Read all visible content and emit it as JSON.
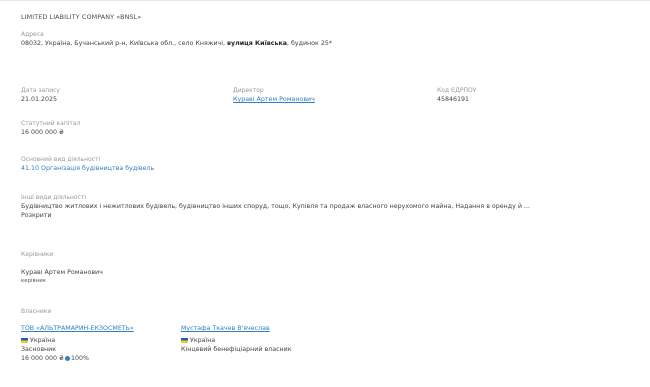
{
  "company": {
    "name": "LIMITED LIABILITY COMPANY «BNSL»"
  },
  "address": {
    "label": "Адреса",
    "prefix": "08032, Україна, Бучанський р-н, Київська обл., село Княжичі, ",
    "street": "вулиця Київська",
    "suffix": ", будинок 25*"
  },
  "registration": {
    "date_label": "Дата запису",
    "date": "21.01.2025",
    "director_label": "Директор",
    "director": "Кураві Артем Романович",
    "code_label": "Код ЄДРПОУ",
    "code": "45846191"
  },
  "capital": {
    "label": "Статутний капітал",
    "value": "16 000 000 ₴"
  },
  "main_activity": {
    "label": "Основний вид діяльності",
    "value": "41.10 Організація будівництва будівель"
  },
  "other_activity": {
    "label": "Інші види діяльності",
    "value": "Будівництво житлових і нежитлових будівель, будівництво інших споруд, тощо, Купівля та продаж власного нерухомого майна, Надання в оренду й ...",
    "expand": "Розкрити"
  },
  "managers": {
    "label": "Керівники",
    "name": "Кураві Артем Романович",
    "role": "керівник"
  },
  "owners": {
    "label": "Власники",
    "owner1": {
      "name": "ТОВ «АЛЬТРАМАРИН-ЕКЗОСМЕТЬ»",
      "country": "Україна",
      "role": "Засновник",
      "share": "16 000 000 ₴",
      "percent": "100%"
    },
    "owner2": {
      "name": "Мустафа Ткачев В'ячеслав",
      "country": "Україна",
      "role": "Кінцевий бенефіціарний власник"
    }
  },
  "colors": {
    "link": "#2f7fc1",
    "label": "#9a9a9a",
    "text": "#444444"
  }
}
